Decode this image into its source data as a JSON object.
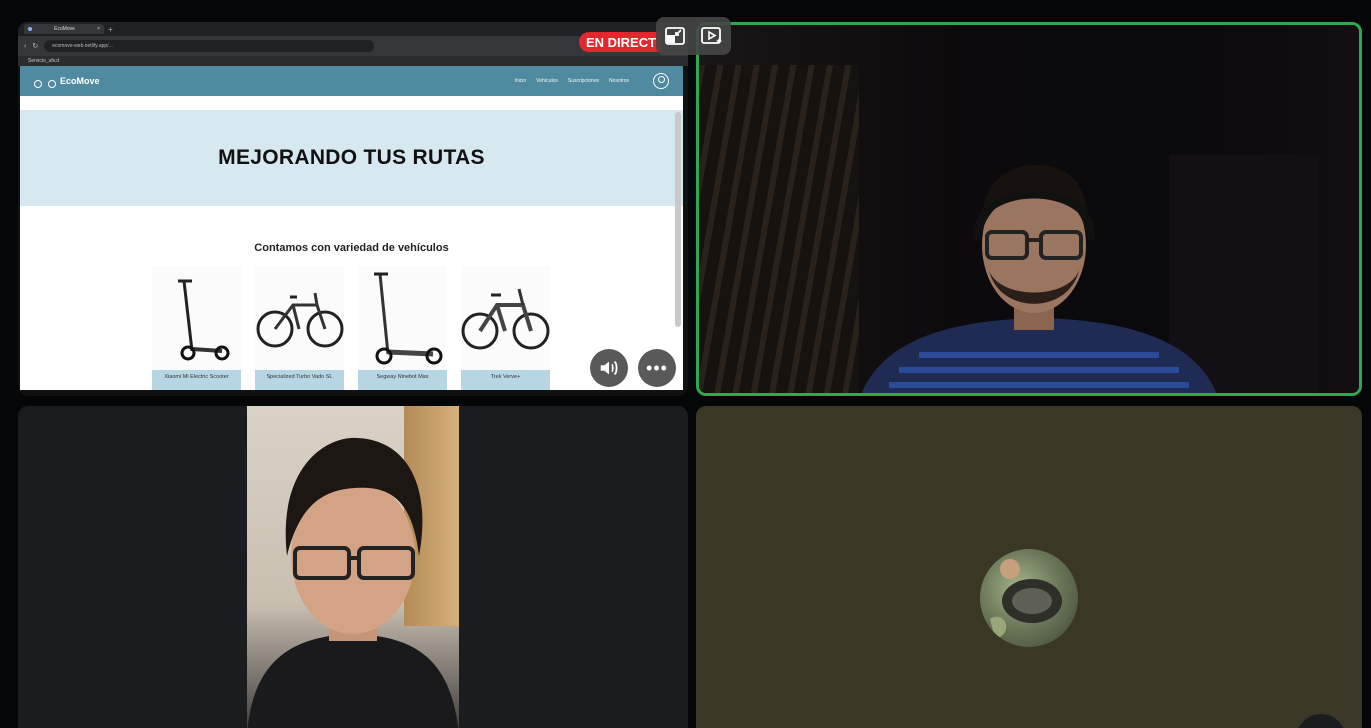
{
  "live_badge": "EN DIRECT",
  "overlay_controls": [
    "exit-fullscreen-icon",
    "picture-in-picture-icon"
  ],
  "shared_screen": {
    "browser": {
      "tab_title": "EcoMove",
      "url": "ecomove-web.netlify.app/...",
      "bookmark": "Servicio_ufv.d"
    },
    "site": {
      "brand": "EcoMove",
      "nav": [
        "Inicio",
        "Vehículos",
        "Suscripciones",
        "Nosotros"
      ],
      "hero_title": "MEJORANDO TUS RUTAS",
      "section_title": "Contamos con variedad de vehículos",
      "vehicles": [
        {
          "label": "Xiaomi Mi Electric Scooter",
          "kind": "scooter"
        },
        {
          "label": "Specialized Turbo Vado SL",
          "kind": "bike"
        },
        {
          "label": "Segway Ninebot Max",
          "kind": "scooter"
        },
        {
          "label": "Trek Verve+",
          "kind": "bike"
        }
      ]
    },
    "controls": {
      "volume": "volume-icon",
      "more": "•••"
    }
  },
  "colors": {
    "active_speaker_border": "#2fa84f",
    "live": "#e0282e",
    "site_nav": "#4f8aa1",
    "hero_bg": "#d6e9f1",
    "label_bg": "#b7d6e4"
  }
}
